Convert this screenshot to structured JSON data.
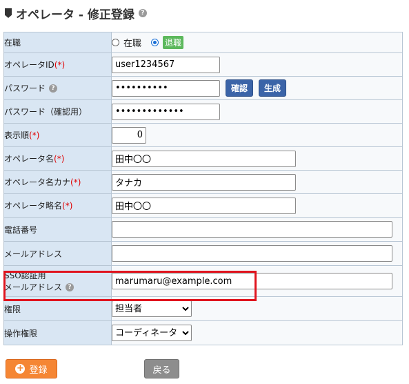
{
  "title": "オペレータ - 修正登録",
  "form": {
    "status": {
      "label": "在職",
      "opt1": "在職",
      "opt2": "退職"
    },
    "operator_id": {
      "label": "オペレータID",
      "req": "(*)",
      "value": "user1234567"
    },
    "password": {
      "label": "パスワード",
      "value": "••••••••••",
      "confirm_btn": "確認",
      "generate_btn": "生成"
    },
    "password_confirm": {
      "label": "パスワード（確認用）",
      "value": "•••••••••••••"
    },
    "display_order": {
      "label": "表示順",
      "req": "(*)",
      "value": "0"
    },
    "operator_name": {
      "label": "オペレータ名",
      "req": "(*)",
      "value": "田中〇〇"
    },
    "operator_kana": {
      "label": "オペレータ名カナ",
      "req": "(*)",
      "value": "タナカ"
    },
    "operator_short": {
      "label": "オペレータ略名",
      "req": "(*)",
      "value": "田中〇〇"
    },
    "phone": {
      "label": "電話番号",
      "value": ""
    },
    "email": {
      "label": "メールアドレス",
      "value": ""
    },
    "sso": {
      "label1": "SSO認証用",
      "label2": "メールアドレス",
      "value": "marumaru@example.com"
    },
    "role": {
      "label": "権限",
      "value": "担当者"
    },
    "op_role": {
      "label": "操作権限",
      "value": "コーディネータ"
    }
  },
  "buttons": {
    "register": "登録",
    "back": "戻る"
  },
  "icons": {
    "help": "?",
    "plus": "+"
  },
  "colors": {
    "highlight": "#e0141e",
    "register_btn": "#f58634",
    "label_bg": "#d9e6f3"
  }
}
